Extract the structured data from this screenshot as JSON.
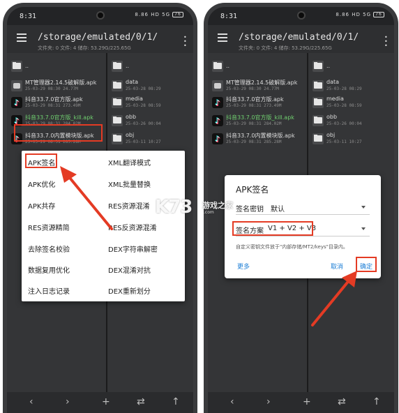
{
  "colors": {
    "highlight": "#e43b24",
    "link": "#1e7fd6",
    "green_file": "#6fcf6f"
  },
  "status": {
    "time": "8:31",
    "signal": "8.86 HD 5G",
    "battery": "76"
  },
  "appbar": {
    "path": "/storage/emulated/0/1/",
    "subtitle": "文件夹: 0  文件: 4  储存: 53.29G/225.65G"
  },
  "left_pane": {
    "items": [
      {
        "icon": "folder-icon",
        "name": "..",
        "meta": ""
      },
      {
        "icon": "apk-icon",
        "name": "MT管理器2.14.5破解版.apk",
        "meta": "25-03-29 08:30  24.77M"
      },
      {
        "icon": "tiktok-icon",
        "name": "抖音33.7.0官方版.apk",
        "meta": "25-03-29 08:31  273.49M"
      },
      {
        "icon": "tiktok-icon",
        "name": "抖音33.7.0官方版_kill.apk",
        "meta": "25-03-29 08:31  284.02M"
      },
      {
        "icon": "tiktok-icon",
        "name": "抖音33.7.0内置模块版.apk",
        "meta": "25-03-29 08:31  285.28M"
      }
    ]
  },
  "right_pane": {
    "items": [
      {
        "name": "data",
        "meta": "25-03-28 08:29"
      },
      {
        "name": "media",
        "meta": "25-03-28 08:59"
      },
      {
        "name": "obb",
        "meta": "25-03-26 00:04"
      },
      {
        "name": "obj",
        "meta": "25-03-11 10:27"
      }
    ]
  },
  "context_menu": {
    "left": [
      "APK签名",
      "APK优化",
      "APK共存",
      "RES资源精简",
      "去除签名校验",
      "数据复用优化",
      "注入日志记录"
    ],
    "right": [
      "XML翻译模式",
      "XML批量替换",
      "RES资源混淆",
      "RES反资源混淆",
      "DEX字符串解密",
      "DEX混淆对抗",
      "DEX重新划分"
    ]
  },
  "dialog": {
    "title": "APK签名",
    "key_label": "签名密钥",
    "key_value": "默认",
    "scheme_label": "签名方案",
    "scheme_value": "V1 + V2 + V3",
    "note": "自定义密钥文件放于\"内部存储/MT2/keys\"目录内。",
    "more": "更多",
    "cancel": "取消",
    "ok": "确定"
  },
  "watermark": {
    "brand": "K73",
    "text": "游戏之家",
    "url": ".com"
  },
  "bottombar": {
    "back": "‹",
    "forward": "›",
    "add": "+",
    "swap": "⇄",
    "up": "↑"
  }
}
